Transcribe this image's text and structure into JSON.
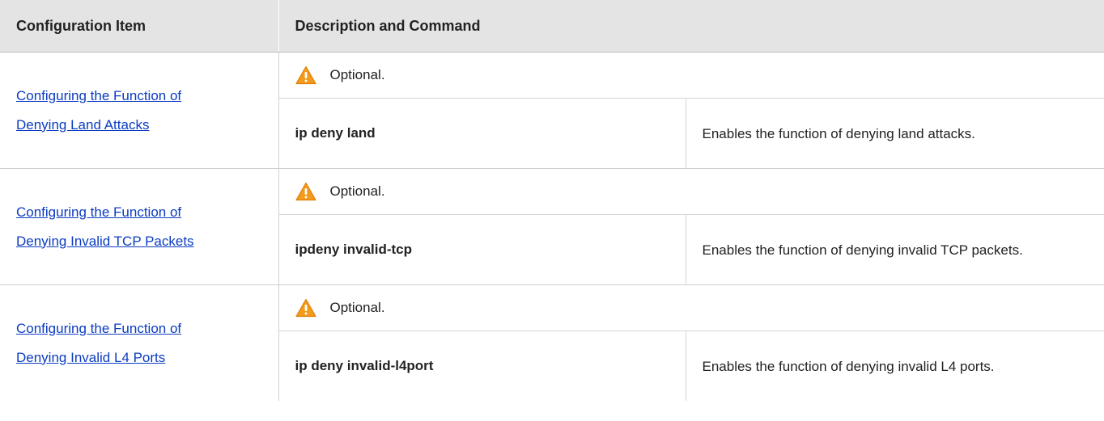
{
  "table": {
    "headers": {
      "item": "Configuration Item",
      "desc": "Description and Command"
    },
    "rows": [
      {
        "item_line1": "Configuring the Function of",
        "item_line2": "Denying Land Attacks",
        "optional": "Optional.",
        "command": "ip deny land",
        "description": "Enables the function of denying land attacks."
      },
      {
        "item_line1": "Configuring the Function of",
        "item_line2": "Denying Invalid TCP Packets",
        "optional": "Optional.",
        "command": "ipdeny invalid-tcp",
        "description": "Enables the function of denying invalid TCP packets."
      },
      {
        "item_line1": "Configuring the Function of",
        "item_line2": "Denying Invalid L4 Ports",
        "optional": "Optional.",
        "command": "ip deny invalid-l4port",
        "description": "Enables the function of denying invalid L4 ports."
      }
    ]
  },
  "icons": {
    "warning": "warning-icon"
  },
  "colors": {
    "header_bg": "#e4e4e4",
    "link": "#0b3cc1",
    "warning_fill": "#f29b1d"
  }
}
